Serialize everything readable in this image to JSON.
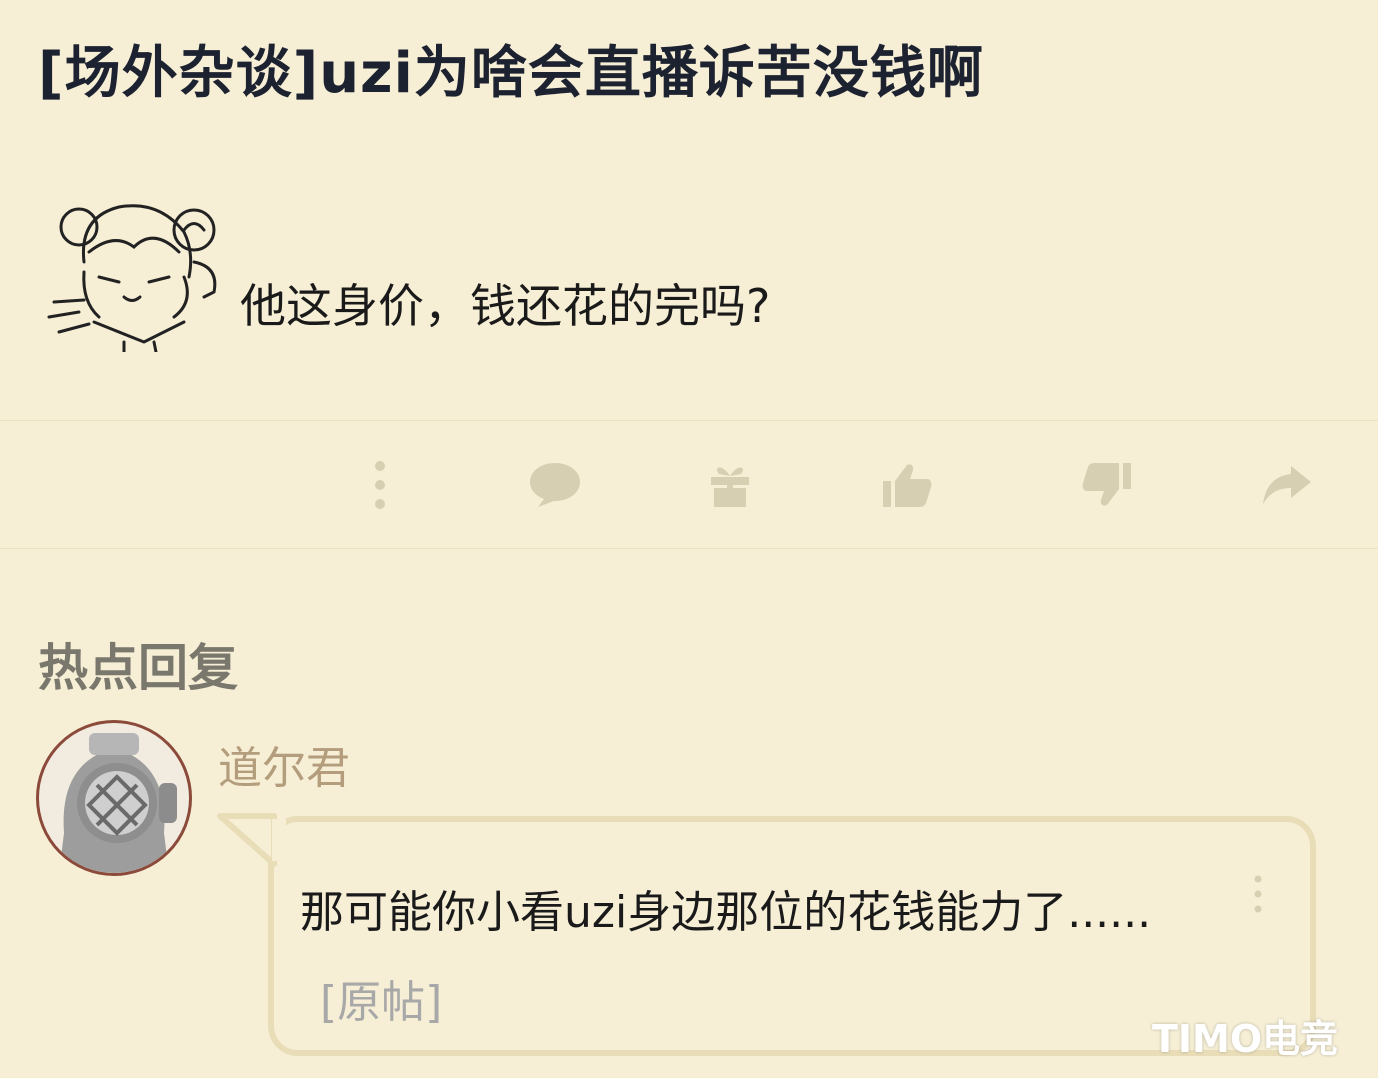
{
  "thread": {
    "title": "[场外杂谈]uzi为啥会直播诉苦没钱啊"
  },
  "post": {
    "text": "他这身价，钱还花的完吗?"
  },
  "actions": {
    "icons": [
      "more-vertical-icon",
      "comment-icon",
      "gift-icon",
      "thumbs-up-icon",
      "thumbs-down-icon",
      "share-icon"
    ]
  },
  "hot_replies": {
    "header": "热点回复",
    "items": [
      {
        "username": "道尔君",
        "text": "那可能你小看uzi身边那位的花钱能力了......",
        "original_link": "[原帖]"
      }
    ]
  },
  "watermark": "TIMO电竞",
  "colors": {
    "background": "#f6efd6",
    "title": "#1d2230",
    "icon": "#d7cfb2",
    "username": "#b39d7c",
    "bubble_border": "#e9ddb8",
    "section_header": "#7a776d"
  }
}
